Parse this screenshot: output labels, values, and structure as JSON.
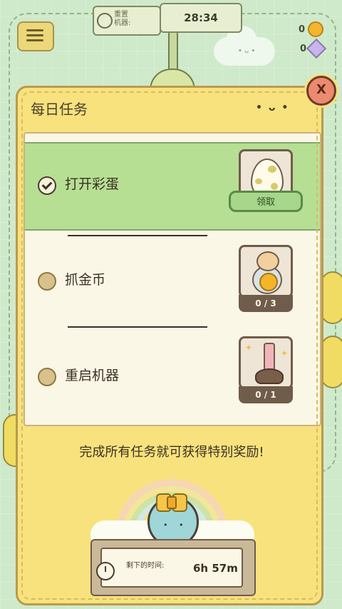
{
  "hud": {
    "reset_label": "重置\n机器:",
    "timer": "28:34",
    "coins": "0",
    "gems": "0"
  },
  "dialog": {
    "title": "每日任务",
    "face": "• ᴗ •",
    "close_label": "X"
  },
  "tasks": [
    {
      "label": "打开彩蛋",
      "completed": true,
      "claim_label": "领取"
    },
    {
      "label": "抓金币",
      "completed": false,
      "progress": "0 / 3"
    },
    {
      "label": "重启机器",
      "completed": false,
      "progress": "0 / 1"
    }
  ],
  "bonus": {
    "text": "完成所有任务就可获得特别奖励!"
  },
  "timer_panel": {
    "label": "剩下的时间:",
    "value": "6h 57m"
  },
  "colors": {
    "dialog_bg": "#f8e27d",
    "done_row": "#b6df94",
    "close_btn": "#ec8a6f",
    "claim_btn": "#a7d78b"
  }
}
